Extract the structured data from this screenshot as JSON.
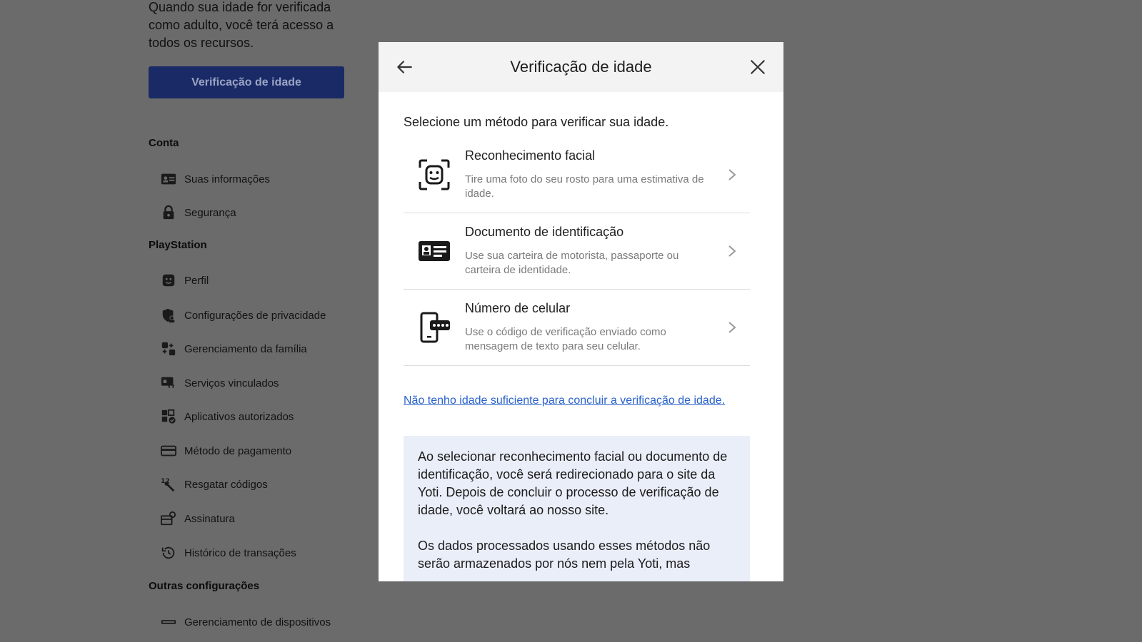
{
  "background": {
    "intro_text": "Quando sua idade for verificada como adulto, você terá acesso a todos os recursos.",
    "verify_button": "Verificação de idade",
    "sections": {
      "conta": "Conta",
      "playstation": "PlayStation",
      "outras": "Outras configurações"
    },
    "nav": {
      "suas_informacoes": "Suas informações",
      "seguranca": "Segurança",
      "perfil": "Perfil",
      "privacidade": "Configurações de privacidade",
      "familia": "Gerenciamento da família",
      "servicos": "Serviços vinculados",
      "aplicativos": "Aplicativos autorizados",
      "pagamento": "Método de pagamento",
      "resgatar": "Resgatar códigos",
      "assinatura": "Assinatura",
      "historico": "Histórico de transações",
      "dispositivos": "Gerenciamento de dispositivos"
    }
  },
  "modal": {
    "title": "Verificação de idade",
    "subtitle": "Selecione um método para verificar sua idade.",
    "options": [
      {
        "title": "Reconhecimento facial",
        "description": "Tire uma foto do seu rosto para uma estimativa de idade.",
        "icon": "face-scan-icon"
      },
      {
        "title": "Documento de identificação",
        "description": "Use sua carteira de motorista, passaporte ou carteira de identidade.",
        "icon": "id-card-icon"
      },
      {
        "title": "Número de celular",
        "description": "Use o código de verificação enviado como mensagem de texto para seu celular.",
        "icon": "phone-code-icon"
      }
    ],
    "link": "Não tenho idade suficiente para concluir a verificação de idade.",
    "info_paragraph_1": "Ao selecionar reconhecimento facial ou documento de identificação, você será redirecionado para o site da Yoti. Depois de concluir o processo de verificação de idade, você voltará ao nosso site.",
    "info_paragraph_2": "Os dados processados usando esses métodos não serão armazenados por nós nem pela Yoti, mas"
  },
  "colors": {
    "overlay": "#6b6b6b",
    "primary_button": "#1a2a66",
    "link": "#2a62c9",
    "info_box": "#eaeef9"
  }
}
